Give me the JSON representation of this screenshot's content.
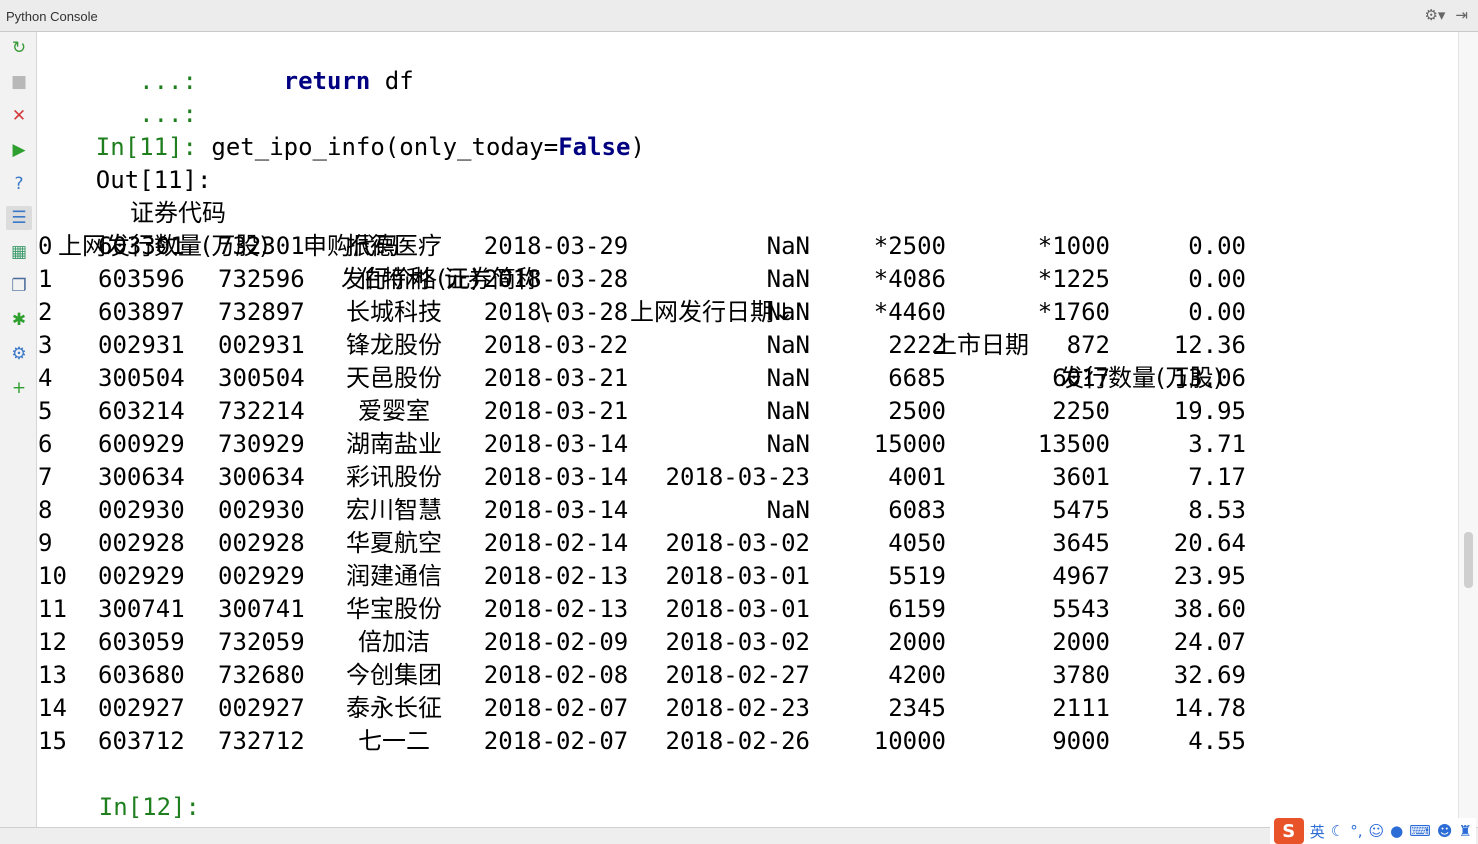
{
  "window": {
    "title": "Python Console"
  },
  "colors": {
    "prompt": "#1f7f1f",
    "keyword": "#000080",
    "text": "#000000"
  },
  "toolbar_icons": [
    "gear-icon",
    "hide-icon"
  ],
  "sidebar": [
    {
      "name": "rerun-icon",
      "glyph": "↻",
      "color": "#3a9a3a"
    },
    {
      "name": "stop-icon",
      "glyph": "■",
      "color": "#b8b8b8"
    },
    {
      "name": "close-icon",
      "glyph": "✕",
      "color": "#d23c3c"
    },
    {
      "name": "execute-icon",
      "glyph": "▶",
      "color": "#2fa02f"
    },
    {
      "name": "help-icon",
      "glyph": "?",
      "color": "#3a78c8"
    },
    {
      "name": "settings-list-icon",
      "glyph": "☰",
      "color": "#3a78c8"
    },
    {
      "name": "show-variables-icon",
      "glyph": "▦",
      "color": "#3a9a6a"
    },
    {
      "name": "history-icon",
      "glyph": "❐",
      "color": "#4a6a9a"
    },
    {
      "name": "debug-icon",
      "glyph": "✱",
      "color": "#2fa02f"
    },
    {
      "name": "settings-icon",
      "glyph": "⚙",
      "color": "#3a78c8"
    },
    {
      "name": "add-icon",
      "glyph": "+",
      "color": "#2fa02f"
    }
  ],
  "code": {
    "line1_dots": "   ...:",
    "line1_kw": "return",
    "line1_rest": " df",
    "line2_dots": "   ...:",
    "in_prompt": "In[11]:",
    "call_func": " get_ipo_info(only_today=",
    "call_kw": "False",
    "call_close": ")",
    "out_prompt": "Out[11]:"
  },
  "table": {
    "header1": [
      "证券代码",
      "申购代码",
      "证券简称",
      "上网发行日期↓",
      "上市日期",
      "发行数量(万股)"
    ],
    "header2": [
      "上网发行数量(万股)",
      "发行价格(元)",
      "\\"
    ],
    "rows": [
      [
        "0",
        "603301",
        "732301",
        "振德医疗",
        "2018-03-29",
        "NaN",
        "*2500",
        "*1000",
        "0.00"
      ],
      [
        "1",
        "603596",
        "732596",
        "伯特利",
        "2018-03-28",
        "NaN",
        "*4086",
        "*1225",
        "0.00"
      ],
      [
        "2",
        "603897",
        "732897",
        "长城科技",
        "2018-03-28",
        "NaN",
        "*4460",
        "*1760",
        "0.00"
      ],
      [
        "3",
        "002931",
        "002931",
        "锋龙股份",
        "2018-03-22",
        "NaN",
        "2222",
        "872",
        "12.36"
      ],
      [
        "4",
        "300504",
        "300504",
        "天邑股份",
        "2018-03-21",
        "NaN",
        "6685",
        "6017",
        "13.06"
      ],
      [
        "5",
        "603214",
        "732214",
        "爱婴室",
        "2018-03-21",
        "NaN",
        "2500",
        "2250",
        "19.95"
      ],
      [
        "6",
        "600929",
        "730929",
        "湖南盐业",
        "2018-03-14",
        "NaN",
        "15000",
        "13500",
        "3.71"
      ],
      [
        "7",
        "300634",
        "300634",
        "彩讯股份",
        "2018-03-14",
        "2018-03-23",
        "4001",
        "3601",
        "7.17"
      ],
      [
        "8",
        "002930",
        "002930",
        "宏川智慧",
        "2018-03-14",
        "NaN",
        "6083",
        "5475",
        "8.53"
      ],
      [
        "9",
        "002928",
        "002928",
        "华夏航空",
        "2018-02-14",
        "2018-03-02",
        "4050",
        "3645",
        "20.64"
      ],
      [
        "10",
        "002929",
        "002929",
        "润建通信",
        "2018-02-13",
        "2018-03-01",
        "5519",
        "4967",
        "23.95"
      ],
      [
        "11",
        "300741",
        "300741",
        "华宝股份",
        "2018-02-13",
        "2018-03-01",
        "6159",
        "5543",
        "38.60"
      ],
      [
        "12",
        "603059",
        "732059",
        "倍加洁",
        "2018-02-09",
        "2018-03-02",
        "2000",
        "2000",
        "24.07"
      ],
      [
        "13",
        "603680",
        "732680",
        "今创集团",
        "2018-02-08",
        "2018-02-27",
        "4200",
        "3780",
        "32.69"
      ],
      [
        "14",
        "002927",
        "002927",
        "泰永长征",
        "2018-02-07",
        "2018-02-23",
        "2345",
        "2111",
        "14.78"
      ],
      [
        "15",
        "603712",
        "732712",
        "七一二",
        "2018-02-07",
        "2018-02-26",
        "10000",
        "9000",
        "4.55"
      ]
    ]
  },
  "next_prompt": "In[12]:",
  "ime": {
    "logo": "S",
    "lang": "英",
    "icons": [
      "moon-icon",
      "punctuation-icon",
      "emoji-icon",
      "mic-icon",
      "keyboard-icon",
      "user-icon",
      "shirt-icon"
    ]
  }
}
